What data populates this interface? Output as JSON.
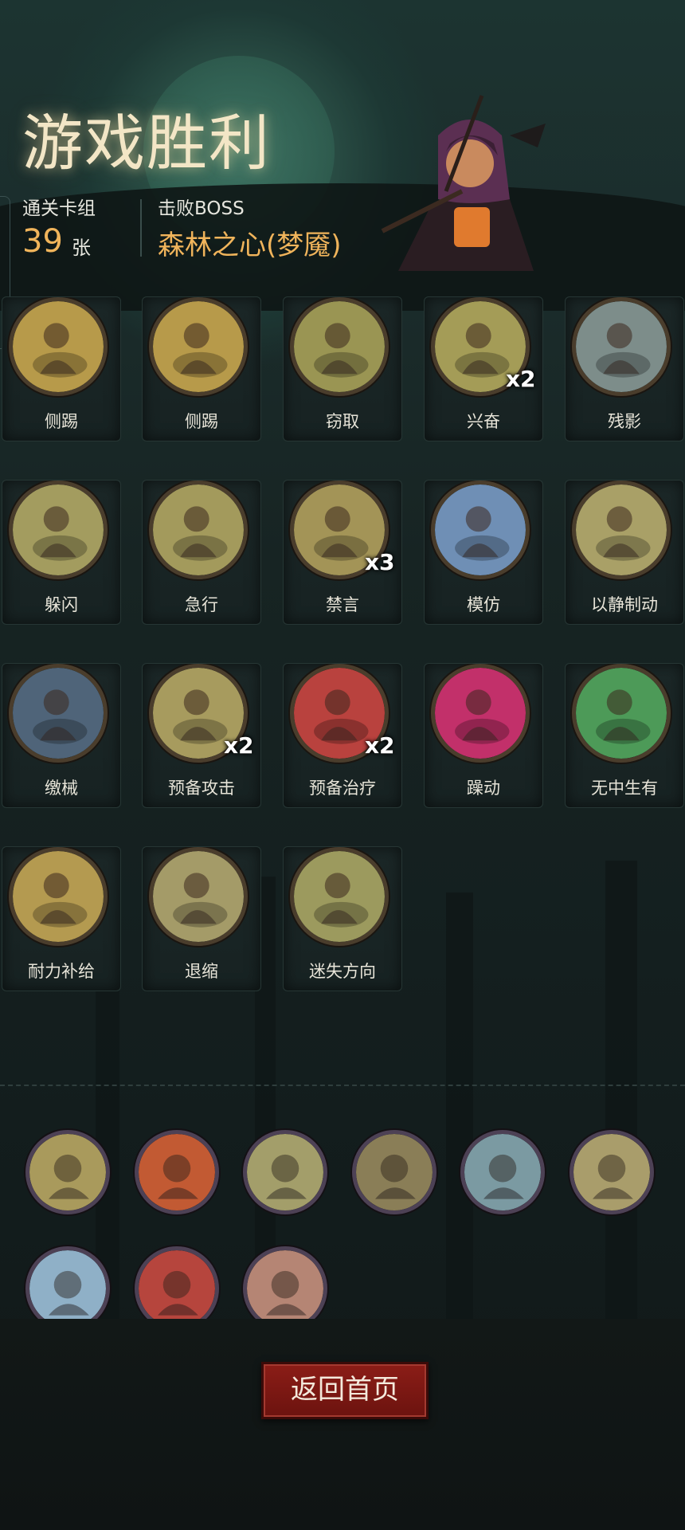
{
  "header": {
    "title": "游戏胜利",
    "deck_label": "通关卡组",
    "deck_count": "39",
    "deck_unit": "张",
    "boss_label": "击败BOSS",
    "boss_name": "森林之心(梦魇)"
  },
  "cards": [
    {
      "name": "侧踢",
      "badge": "",
      "palette": "#b79a4a"
    },
    {
      "name": "侧踢",
      "badge": "",
      "palette": "#b79a4a"
    },
    {
      "name": "窃取",
      "badge": "",
      "palette": "#9a9553"
    },
    {
      "name": "兴奋",
      "badge": "x2",
      "palette": "#a49c57"
    },
    {
      "name": "残影",
      "badge": "",
      "palette": "#7d8d8a"
    },
    {
      "name": "躲闪",
      "badge": "",
      "palette": "#a39c5f"
    },
    {
      "name": "急行",
      "badge": "",
      "palette": "#a39a5c"
    },
    {
      "name": "禁言",
      "badge": "x3",
      "palette": "#a39457"
    },
    {
      "name": "模仿",
      "badge": "",
      "palette": "#6f8fb5"
    },
    {
      "name": "以静制动",
      "badge": "",
      "palette": "#a9a067"
    },
    {
      "name": "缴械",
      "badge": "",
      "palette": "#4f6479"
    },
    {
      "name": "预备攻击",
      "badge": "x2",
      "palette": "#a79b5e"
    },
    {
      "name": "预备治疗",
      "badge": "x2",
      "palette": "#b9423e"
    },
    {
      "name": "躁动",
      "badge": "",
      "palette": "#c2306a"
    },
    {
      "name": "无中生有",
      "badge": "",
      "palette": "#4d9a58"
    },
    {
      "name": "耐力补给",
      "badge": "",
      "palette": "#b49a50"
    },
    {
      "name": "退缩",
      "badge": "",
      "palette": "#a49b68"
    },
    {
      "name": "迷失方向",
      "badge": "",
      "palette": "#9c9a5e"
    }
  ],
  "relics": [
    {
      "icon": "hourglass-icon",
      "palette": "#a99a5c"
    },
    {
      "icon": "fire-mask-icon",
      "palette": "#c25a33"
    },
    {
      "icon": "hooded-figure-icon",
      "palette": "#a39e6a"
    },
    {
      "icon": "sword-coins-icon",
      "palette": "#8a7e57"
    },
    {
      "icon": "treasure-chest-icon",
      "palette": "#7b9aa2"
    },
    {
      "icon": "hand-card-icon",
      "palette": "#a99d6b"
    },
    {
      "icon": "dagger-icon",
      "palette": "#8fb0c7"
    },
    {
      "icon": "goblin-guitar-icon",
      "palette": "#b6453d"
    },
    {
      "icon": "bloody-hands-icon",
      "palette": "#b58574"
    }
  ],
  "footer": {
    "home_button": "返回首页"
  }
}
